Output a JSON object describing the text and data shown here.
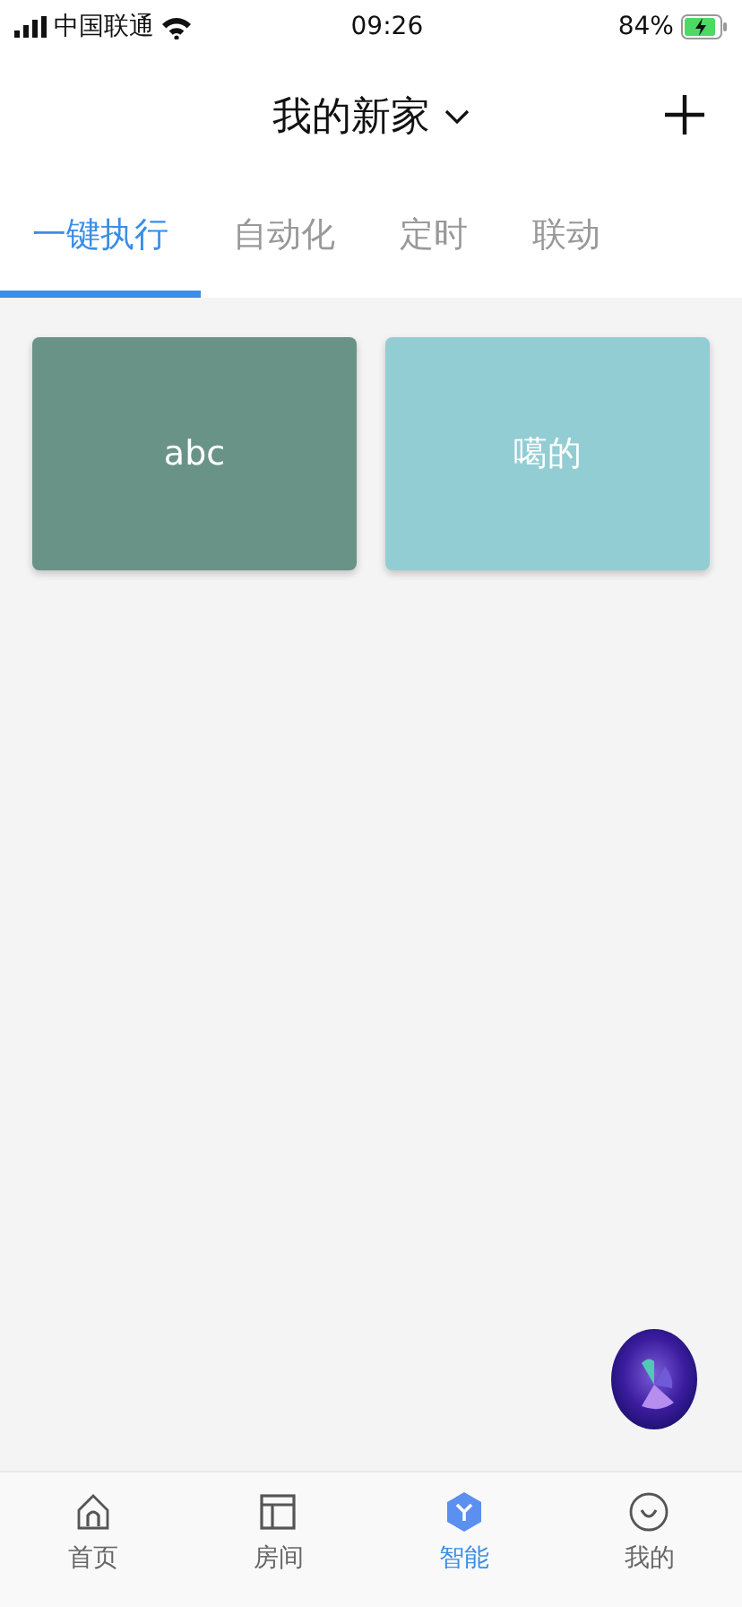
{
  "status_bar": {
    "carrier": "中国联通",
    "time": "09:26",
    "battery": "84%"
  },
  "header": {
    "title": "我的新家"
  },
  "tabs": [
    {
      "label": "一键执行",
      "selected": true
    },
    {
      "label": "自动化",
      "selected": false
    },
    {
      "label": "定时",
      "selected": false
    },
    {
      "label": "联动",
      "selected": false
    }
  ],
  "scenes": [
    {
      "label": "abc",
      "color": "#6a9388"
    },
    {
      "label": "噶的",
      "color": "#92cdd3"
    }
  ],
  "bottom_nav": [
    {
      "kind": "home",
      "label": "首页",
      "selected": false
    },
    {
      "kind": "room",
      "label": "房间",
      "selected": false
    },
    {
      "kind": "smart",
      "label": "智能",
      "selected": true
    },
    {
      "kind": "mine",
      "label": "我的",
      "selected": false
    }
  ]
}
